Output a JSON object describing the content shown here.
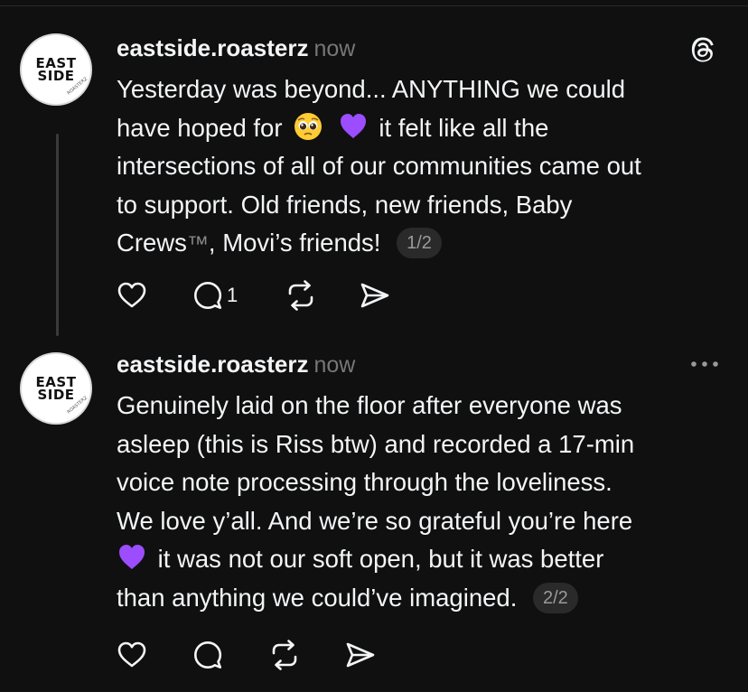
{
  "posts": [
    {
      "username": "eastside.roasterz",
      "timestamp": "now",
      "avatar": {
        "logo_line1": "EAST",
        "logo_line2": "SIDE",
        "ring_text": "ROASTERZ"
      },
      "corner_icon": "threads-logo-icon",
      "text": {
        "line1": "Yesterday was beyond... ANYTHING we could",
        "line2_a": "have hoped for",
        "line2_b": "it felt like all the",
        "line3": "intersections of all of our communities came out",
        "line4": "to support. Old friends, new friends, Baby",
        "line5_a": "Crews",
        "line5_tm": "™",
        "line5_b": ", Movi’s friends!"
      },
      "emojis": [
        "pleading-face-emoji",
        "purple-heart-emoji"
      ],
      "page_indicator": "1/2",
      "actions": {
        "like_icon": "heart-icon",
        "reply_icon": "comment-icon",
        "reply_count": "1",
        "repost_icon": "repost-icon",
        "share_icon": "send-icon"
      }
    },
    {
      "username": "eastside.roasterz",
      "timestamp": "now",
      "avatar": {
        "logo_line1": "EAST",
        "logo_line2": "SIDE",
        "ring_text": "ROASTERZ"
      },
      "corner_icon": "more-options-icon",
      "text": {
        "line1": "Genuinely laid on the floor after everyone was",
        "line2": "asleep (this is Riss btw) and recorded a 17-min",
        "line3": "voice note processing through the loveliness.",
        "line4": "We love y’all. And we’re so grateful you’re here",
        "line5": "it was not our soft open, but it was better",
        "line6": "than anything we could’ve imagined."
      },
      "emojis": [
        "purple-heart-emoji"
      ],
      "page_indicator": "2/2",
      "actions": {
        "like_icon": "heart-icon",
        "reply_icon": "comment-icon",
        "repost_icon": "repost-icon",
        "share_icon": "send-icon"
      }
    }
  ],
  "colors": {
    "background": "#101010",
    "text": "#f3f5f7",
    "muted": "#777777",
    "thread_line": "#3a3a3a",
    "pill_bg": "#2a2a2a",
    "purple_heart": "#9b4dff",
    "emoji_yellow": "#ffcc33"
  }
}
